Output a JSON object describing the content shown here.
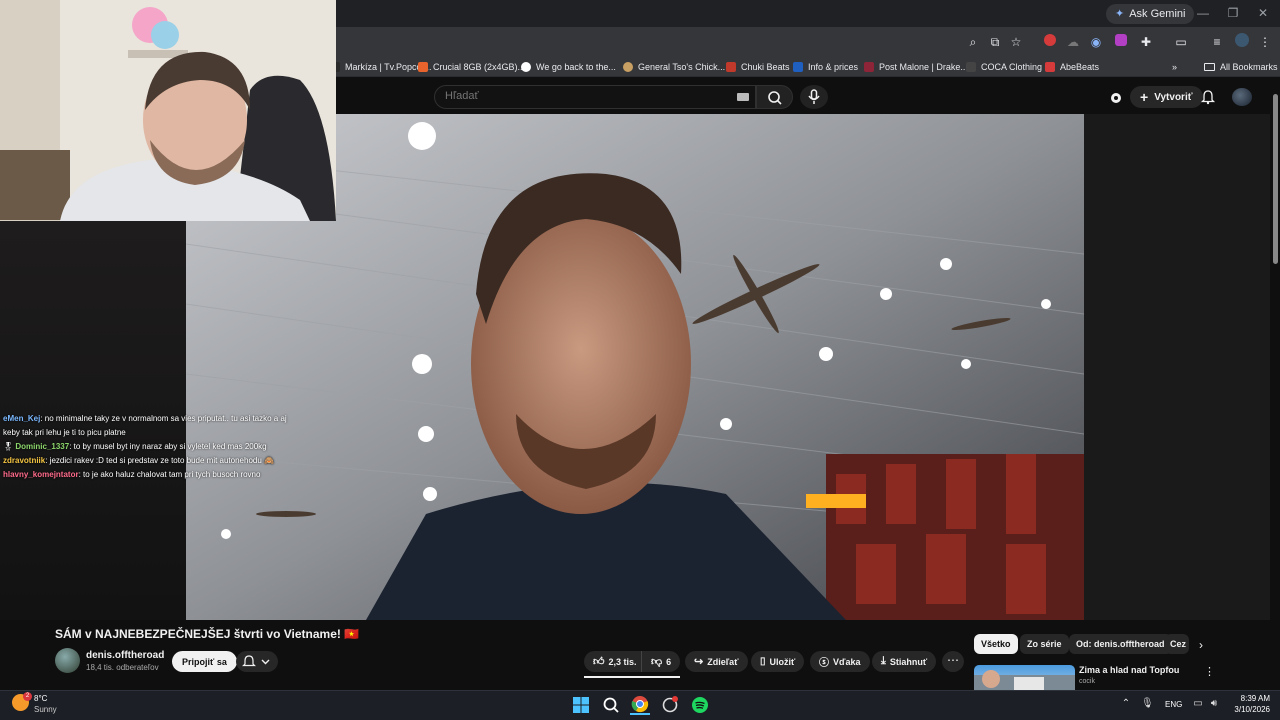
{
  "browser": {
    "ask_gemini": "Ask Gemini",
    "bookmarks": [
      {
        "label": "Markíza | Tv.Popcor...",
        "color": "#2a2a2a"
      },
      {
        "label": "Crucial 8GB (2x4GB)...",
        "color": "#e8642c"
      },
      {
        "label": "We go back to the...",
        "color": "#4285f4"
      },
      {
        "label": "General Tso's Chick...",
        "color": "#c9a063"
      },
      {
        "label": "Chuki Beats",
        "color": "#c0392b"
      },
      {
        "label": "Info & prices",
        "color": "#1f5fbf"
      },
      {
        "label": "Post Malone | Drake...",
        "color": "#8e2437"
      },
      {
        "label": "COCA Clothing",
        "color": "#444444"
      },
      {
        "label": "AbeBeats",
        "color": "#d63b3b"
      }
    ],
    "all_bookmarks": "All Bookmarks"
  },
  "youtube": {
    "search_placeholder": "Hľadať",
    "create_label": "Vytvoriť"
  },
  "chat": [
    {
      "user": "eMen_Kej",
      "color": "#7ab8ff",
      "text": ": no minimalne taky ze v normalnom sa vies priputat.. tu asi tazko a aj keby tak pri lehu je ti to picu platne"
    },
    {
      "user": "Dominic_1337",
      "color": "#8cd66b",
      "badge": "🎖",
      "text": ": to by musel byt iny naraz aby si vyletel ked mas 200kg"
    },
    {
      "user": "zdravotniik",
      "color": "#f4c542",
      "text": ": jezdici rakev :D ted si predstav ze toto bude mit autonehodu 🙈"
    },
    {
      "user": "hlavny_komejntator",
      "color": "#ff6b8b",
      "text": ": to je ako haluz chalovat tam pri tych busoch rovno"
    }
  ],
  "video": {
    "title": "SÁM v NAJNEBEZPEČNEJŠEJ štvrti vo Vietname! 🇻🇳",
    "channel_name": "denis.offtheroad",
    "subscribers": "18,4 tis. odberateľov",
    "join_label": "Pripojiť sa",
    "likes": "2,3 tis.",
    "dislikes": "6",
    "share_label": "Zdieľať",
    "save_label": "Uložiť",
    "thanks_label": "Vďaka",
    "download_label": "Stiahnuť"
  },
  "chips": [
    "Všetko",
    "Zo série",
    "Od: denis.offtheroad",
    "Cez"
  ],
  "recommended": {
    "title": "Zima a hlad nad Topfou",
    "channel": "cocik"
  },
  "taskbar": {
    "temperature": "8°C",
    "weather": "Sunny",
    "weather_badge": "2",
    "language": "ENG",
    "time": "8:39 AM",
    "date": "3/10/2026"
  }
}
